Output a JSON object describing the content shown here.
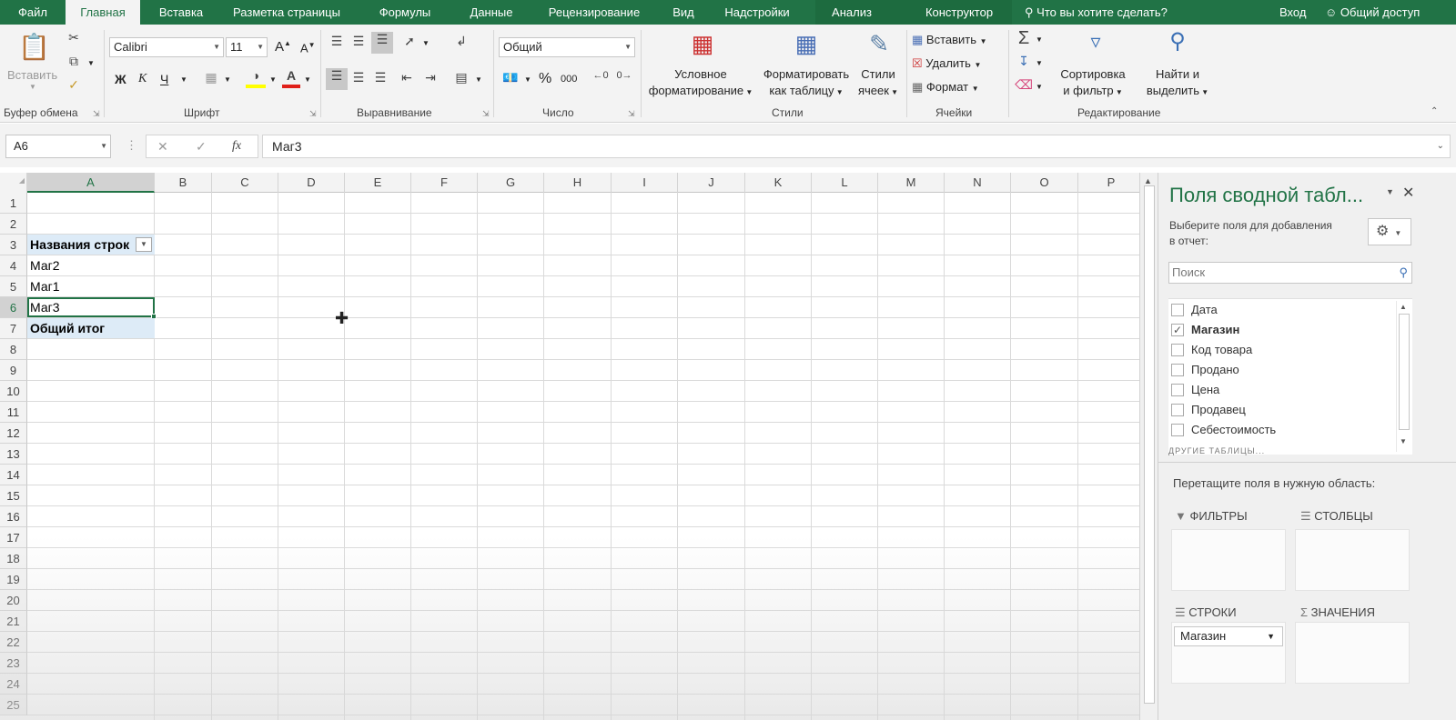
{
  "tabs": [
    "Файл",
    "Главная",
    "Вставка",
    "Разметка страницы",
    "Формулы",
    "Данные",
    "Рецензирование",
    "Вид",
    "Надстройки",
    "Анализ",
    "Конструктор"
  ],
  "tell_me": "Что вы хотите сделать?",
  "signin": "Вход",
  "share": "Общий доступ",
  "accent": "#217346",
  "ribbon": {
    "clipboard": {
      "paste": "Вставить",
      "label": "Буфер обмена"
    },
    "font": {
      "name": "Calibri",
      "size": "11",
      "bold": "Ж",
      "italic": "К",
      "underline": "Ч",
      "grow": "A",
      "shrink": "A",
      "label": "Шрифт"
    },
    "alignment": {
      "label": "Выравнивание"
    },
    "number": {
      "format": "Общий",
      "percent": "%",
      "thousands": "000",
      "label": "Число"
    },
    "styles": {
      "cond_line1": "Условное",
      "cond_line2": "форматирование",
      "table_line1": "Форматировать",
      "table_line2": "как таблицу",
      "cell_line1": "Стили",
      "cell_line2": "ячеек",
      "label": "Стили"
    },
    "cells": {
      "insert": "Вставить",
      "delete": "Удалить",
      "format": "Формат",
      "label": "Ячейки"
    },
    "editing": {
      "sort_line1": "Сортировка",
      "sort_line2": "и фильтр",
      "find_line1": "Найти и",
      "find_line2": "выделить",
      "label": "Редактирование"
    }
  },
  "formula_bar": {
    "name_box": "A6",
    "fx": "fx",
    "value": "Маг3"
  },
  "columns": [
    "A",
    "B",
    "C",
    "D",
    "E",
    "F",
    "G",
    "H",
    "I",
    "J",
    "K",
    "L",
    "M",
    "N",
    "O",
    "P"
  ],
  "rows": [
    "1",
    "2",
    "3",
    "4",
    "5",
    "6",
    "7",
    "8",
    "9",
    "10",
    "11",
    "12",
    "13",
    "14",
    "15",
    "16",
    "17",
    "18",
    "19",
    "20",
    "21",
    "22",
    "23",
    "24",
    "25"
  ],
  "cells": {
    "A3": "Названия строк",
    "A4": "Маг2",
    "A5": "Маг1",
    "A6": "Маг3",
    "A7": "Общий итог"
  },
  "pane": {
    "title": "Поля сводной табл...",
    "instruction_line1": "Выберите поля для добавления",
    "instruction_line2": "в отчет:",
    "search_placeholder": "Поиск",
    "fields": [
      {
        "name": "Дата",
        "checked": false
      },
      {
        "name": "Магазин",
        "checked": true
      },
      {
        "name": "Код товара",
        "checked": false
      },
      {
        "name": "Продано",
        "checked": false
      },
      {
        "name": "Цена",
        "checked": false
      },
      {
        "name": "Продавец",
        "checked": false
      },
      {
        "name": "Себестоимость",
        "checked": false
      }
    ],
    "more_tables": "ДРУГИЕ ТАБЛИЦЫ...",
    "drag_hint": "Перетащите поля в нужную область:",
    "filters": "ФИЛЬТРЫ",
    "columns": "СТОЛБЦЫ",
    "rows": "СТРОКИ",
    "values": "ЗНАЧЕНИЯ",
    "row_field": "Магазин"
  }
}
